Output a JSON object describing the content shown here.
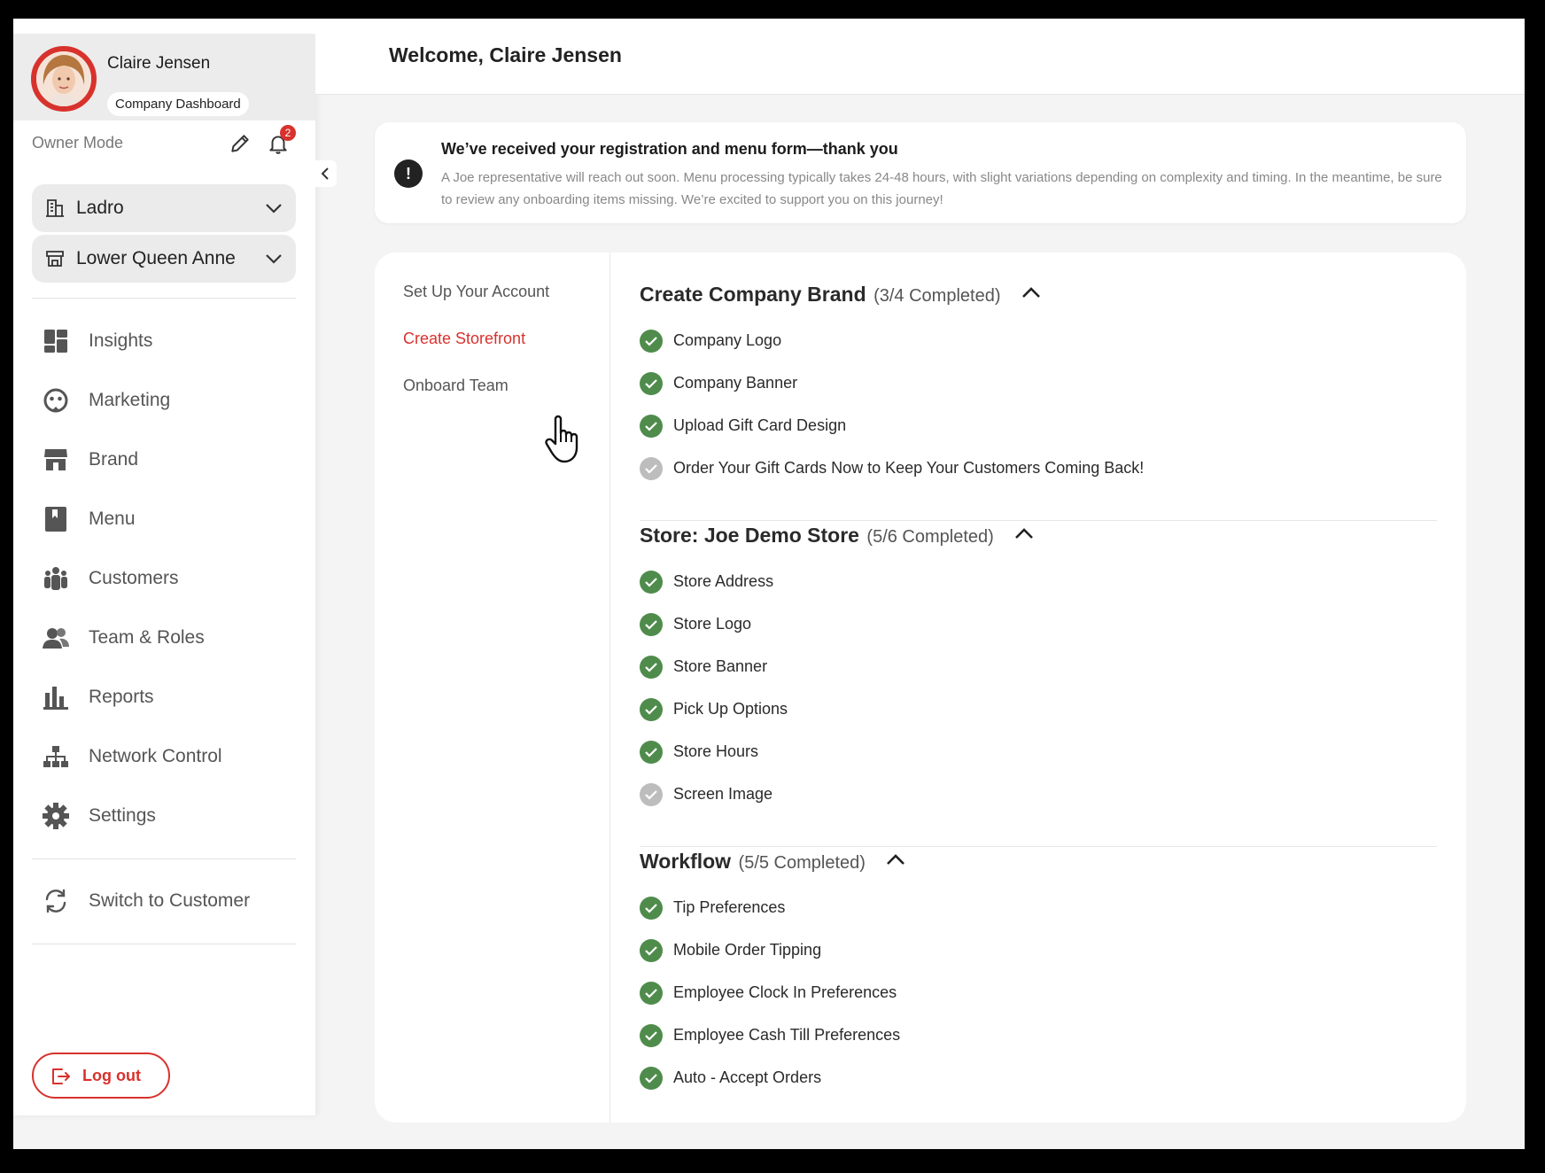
{
  "profile": {
    "name": "Claire Jensen",
    "dashboard_label": "Company Dashboard",
    "mode_label": "Owner Mode",
    "notification_count": "2"
  },
  "selectors": {
    "company": "Ladro",
    "store": "Lower Queen Anne"
  },
  "nav": {
    "items": [
      {
        "label": "Insights",
        "icon": "insights-icon"
      },
      {
        "label": "Marketing",
        "icon": "marketing-icon"
      },
      {
        "label": "Brand",
        "icon": "storefront-icon"
      },
      {
        "label": "Menu",
        "icon": "menu-book-icon"
      },
      {
        "label": "Customers",
        "icon": "customers-icon"
      },
      {
        "label": "Team & Roles",
        "icon": "team-icon"
      },
      {
        "label": "Reports",
        "icon": "bar-chart-icon"
      },
      {
        "label": "Network Control",
        "icon": "network-icon"
      },
      {
        "label": "Settings",
        "icon": "gear-icon"
      }
    ],
    "switch_label": "Switch to Customer",
    "logout_label": "Log out"
  },
  "header": {
    "welcome": "Welcome, Claire Jensen"
  },
  "notice": {
    "title": "We’ve received your registration and menu form—thank you",
    "body": "A Joe representative will reach out soon. Menu processing typically takes 24-48 hours, with slight variations depending on complexity and timing. In the meantime, be sure to review any onboarding items missing. We’re excited to support you on this journey!"
  },
  "steps": [
    {
      "label": "Set Up Your Account",
      "active": false
    },
    {
      "label": "Create Storefront",
      "active": true
    },
    {
      "label": "Onboard Team",
      "active": false
    }
  ],
  "sections": [
    {
      "title": "Create Company Brand",
      "count": "(3/4 Completed)",
      "tasks": [
        {
          "label": "Company Logo",
          "done": true
        },
        {
          "label": "Company Banner",
          "done": true
        },
        {
          "label": "Upload Gift Card Design",
          "done": true
        },
        {
          "label": "Order Your Gift Cards Now to Keep Your Customers Coming Back!",
          "done": false
        }
      ]
    },
    {
      "title": "Store: Joe Demo Store",
      "count": "(5/6 Completed)",
      "tasks": [
        {
          "label": "Store Address",
          "done": true
        },
        {
          "label": "Store Logo",
          "done": true
        },
        {
          "label": "Store Banner",
          "done": true
        },
        {
          "label": "Pick Up Options",
          "done": true
        },
        {
          "label": "Store Hours",
          "done": true
        },
        {
          "label": "Screen Image",
          "done": false
        }
      ]
    },
    {
      "title": "Workflow",
      "count": "(5/5 Completed)",
      "tasks": [
        {
          "label": "Tip Preferences",
          "done": true
        },
        {
          "label": "Mobile Order Tipping",
          "done": true
        },
        {
          "label": "Employee Clock In Preferences",
          "done": true
        },
        {
          "label": "Employee Cash Till Preferences",
          "done": true
        },
        {
          "label": "Auto - Accept Orders",
          "done": true
        }
      ]
    }
  ],
  "colors": {
    "accent": "#d8322d",
    "done": "#4f8c4c",
    "todo": "#bdbdbd"
  }
}
